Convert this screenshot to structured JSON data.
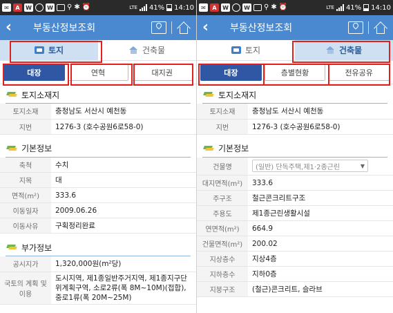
{
  "status_bar": {
    "icons": [
      "message-icon",
      "app-badge-icon",
      "app-w-icon",
      "ring-icon",
      "app-w-icon",
      "screen-icon",
      "location-icon",
      "bluetooth-icon",
      "alarm-icon"
    ],
    "lte": "LTE",
    "battery": "41%",
    "time": "14:10"
  },
  "header": {
    "title": "부동산정보조회"
  },
  "tabs": {
    "land": "토지",
    "building": "건축물"
  },
  "left": {
    "subtabs": [
      "대장",
      "연혁",
      "대지권"
    ],
    "sections": {
      "location": {
        "title": "토지소재지",
        "rows": [
          {
            "label": "토지소재",
            "value": "충청남도 서산시 예천동"
          },
          {
            "label": "지번",
            "value": "1276-3 (호수공원6로58-0)"
          }
        ]
      },
      "basic": {
        "title": "기본정보",
        "rows": [
          {
            "label": "축척",
            "value": "수치"
          },
          {
            "label": "지목",
            "value": "대"
          },
          {
            "label": "면적(m²)",
            "value": "333.6"
          },
          {
            "label": "이동일자",
            "value": "2009.06.26"
          },
          {
            "label": "이동사유",
            "value": "구획정리완료"
          }
        ]
      },
      "extra": {
        "title": "부가정보",
        "rows": [
          {
            "label": "공시지가",
            "value": "1,320,000원(m²당)"
          },
          {
            "label": "국토의 계획 및 이용",
            "value": "도시지역, 제1종일반주거지역, 제1종지구단위계획구역, 소로2류(폭 8M~10M)(접합), 중로1류(폭 20M~25M)"
          }
        ]
      }
    }
  },
  "right": {
    "subtabs": [
      "대장",
      "층별현황",
      "전유공유"
    ],
    "sections": {
      "location": {
        "title": "토지소재지",
        "rows": [
          {
            "label": "토지소재",
            "value": "충청남도 서산시 예천동"
          },
          {
            "label": "지번",
            "value": "1276-3 (호수공원6로58-0)"
          }
        ]
      },
      "basic": {
        "title": "기본정보",
        "building_select": {
          "label": "건물명",
          "value": "(일반) 단독주택,제1·2종근린"
        },
        "rows": [
          {
            "label": "대지면적(m²)",
            "value": "333.6"
          },
          {
            "label": "주구조",
            "value": "철근콘크리트구조"
          },
          {
            "label": "주용도",
            "value": "제1종근린생활시설"
          },
          {
            "label": "연면적(m²)",
            "value": "664.9"
          },
          {
            "label": "건물면적(m²)",
            "value": "200.02"
          },
          {
            "label": "지상층수",
            "value": "지상4층"
          },
          {
            "label": "지하층수",
            "value": "지하0층"
          },
          {
            "label": "지붕구조",
            "value": "(철근)콘크리트, 슬라브"
          }
        ]
      }
    }
  },
  "colors": {
    "header": "#4a88d0",
    "active_tab": "#cfe0f3",
    "active_subtab": "#2f57a4",
    "highlight_box": "#e0201c"
  }
}
